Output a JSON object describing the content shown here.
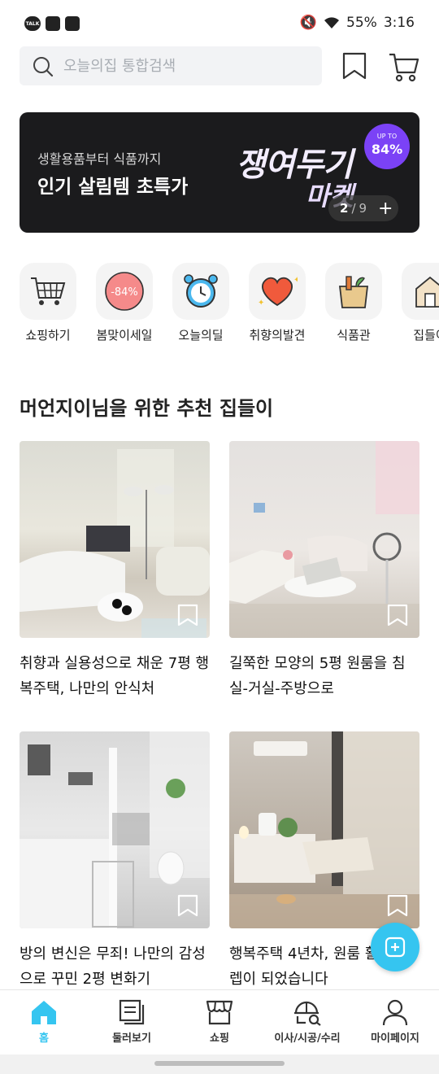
{
  "status_bar": {
    "battery": "55%",
    "time": "3:16"
  },
  "search": {
    "placeholder": "오늘의집 통합검색"
  },
  "banner": {
    "subtitle": "생활용품부터 식품까지",
    "title": "인기 살림템 초특가",
    "art_line1": "쟁여두기",
    "art_line2": "마켓",
    "badge_up": "UP TO",
    "badge_pct": "84%",
    "page_current": "2",
    "page_total": "9"
  },
  "categories": [
    {
      "label": "쇼핑하기",
      "icon": "cart-icon"
    },
    {
      "label": "봄맞이세일",
      "icon": "sale-84-icon",
      "icon_text": "-84%"
    },
    {
      "label": "오늘의딜",
      "icon": "alarm-clock-icon"
    },
    {
      "label": "취향의발견",
      "icon": "heart-icon"
    },
    {
      "label": "식품관",
      "icon": "grocery-bag-icon"
    },
    {
      "label": "집들이",
      "icon": "house-icon"
    }
  ],
  "section": {
    "title": "머언지이님을 위한 추천 집들이"
  },
  "cards": [
    {
      "title": "취향과 실용성으로 채운 7평 행복주택, 나만의 안식처"
    },
    {
      "title": "길쭉한 모양의 5평 원룸을 침실-거실-주방으로"
    },
    {
      "title": "방의 변신은 무죄! 나만의 감성으로 꾸민 2평 변화기"
    },
    {
      "title": "행복주택 4년차, 원룸 활용 만렙이 되었습니다"
    }
  ],
  "bottom_nav": [
    {
      "label": "홈",
      "icon": "home-icon",
      "active": true
    },
    {
      "label": "둘러보기",
      "icon": "feed-icon"
    },
    {
      "label": "쇼핑",
      "icon": "store-icon"
    },
    {
      "label": "이사/시공/수리",
      "icon": "construction-icon"
    },
    {
      "label": "마이페이지",
      "icon": "person-icon"
    }
  ],
  "colors": {
    "accent": "#35c5f0",
    "banner_bg": "#1b1b1d",
    "badge": "#7b42f6"
  }
}
